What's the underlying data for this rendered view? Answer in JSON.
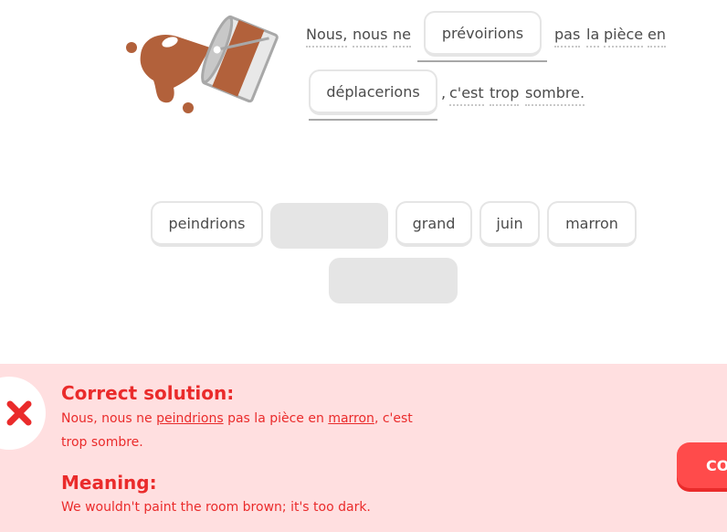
{
  "sentence": {
    "word1": "Nous,",
    "word2": "nous",
    "word3": "ne",
    "blank1_answer": "prévoirions",
    "word4": "pas",
    "word5": "la",
    "word6": "pièce",
    "word7": "en",
    "blank2_answer": "déplacerions",
    "comma": ",",
    "word8": "c'est",
    "word9": "trop",
    "word10": "sombre."
  },
  "word_bank": {
    "chip1": "peindrions",
    "chip3": "grand",
    "chip4": "juin",
    "chip5": "marron"
  },
  "feedback": {
    "correct_heading": "Correct solution:",
    "solution_part1": "Nous, nous ne ",
    "solution_word1": "peindrions",
    "solution_part2": " pas la pièce en ",
    "solution_word2": "marron",
    "solution_part3": ", c'est trop sombre.",
    "meaning_heading": "Meaning:",
    "meaning_text": "We wouldn't paint the room brown; it's too dark.",
    "continue_label": "CONTINUE"
  },
  "colors": {
    "error_red": "#ea2b2b",
    "feedback_bg": "#ffdfe0",
    "paint_brown": "#b2613b",
    "chip_border": "#e5e5e5"
  }
}
